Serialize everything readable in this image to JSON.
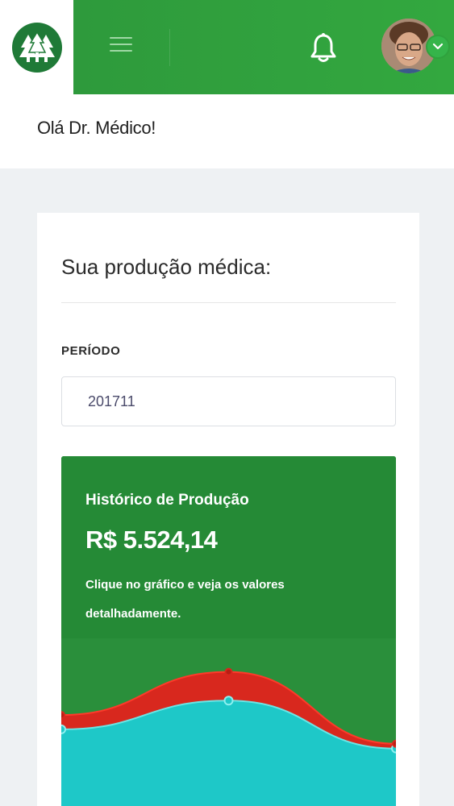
{
  "header": {
    "logo_icon": "pine-trees-logo-icon",
    "menu_icon": "hamburger-menu-icon",
    "notification_icon": "bell-icon",
    "avatar_status_icon": "check-icon",
    "colors": {
      "bar": "#33a83f",
      "logo_bg": "#1f7a37"
    }
  },
  "greeting": "Olá Dr. Médico!",
  "production": {
    "title": "Sua produção médica:",
    "period_label": "PERÍODO",
    "period_value": "201711",
    "history": {
      "title": "Histórico de Produção",
      "total": "R$ 5.524,14",
      "hint": "Clique no gráfico e veja os valores detalhadamente."
    }
  },
  "chart_data": {
    "type": "area",
    "stacked": true,
    "x": [
      1,
      2,
      3
    ],
    "series": [
      {
        "color": "#1ec8c8",
        "values": [
          1.6,
          2.2,
          1.2
        ]
      },
      {
        "color": "#d8281e",
        "values": [
          0.3,
          0.6,
          0.1
        ]
      }
    ],
    "ylim": [
      0,
      3.5
    ],
    "grid": false
  }
}
